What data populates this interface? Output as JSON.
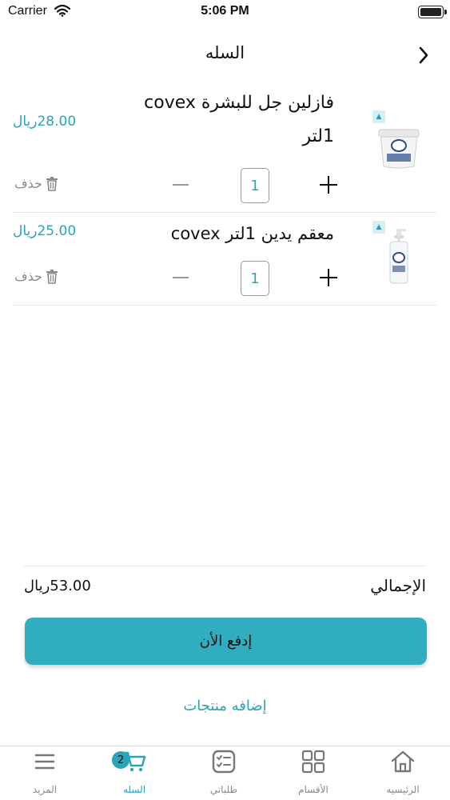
{
  "status_bar": {
    "carrier": "Carrier",
    "time": "5:06 PM"
  },
  "nav": {
    "title": "السله"
  },
  "cart": {
    "items": [
      {
        "name_line1": "فازلين جل للبشرة covex",
        "name_line2": "1لتر",
        "price": "28.00ريال",
        "quantity": "1",
        "delete_label": "حذف"
      },
      {
        "name_line1": "معقم يدين 1لتر covex",
        "price": "25.00ريال",
        "quantity": "1",
        "delete_label": "حذف"
      }
    ]
  },
  "summary": {
    "total_label": "الإجمالي",
    "total_value": "53.00ريال"
  },
  "actions": {
    "pay_label": "إدفع الأن",
    "add_products_label": "إضافه منتجات"
  },
  "tab_bar": {
    "tabs": [
      {
        "label": "الرئيسيه",
        "icon": "home-icon"
      },
      {
        "label": "الأقسام",
        "icon": "grid-icon"
      },
      {
        "label": "طلباتي",
        "icon": "checklist-icon"
      },
      {
        "label": "السله",
        "icon": "cart-icon",
        "badge": "2"
      },
      {
        "label": "المزيد",
        "icon": "menu-icon"
      }
    ]
  },
  "colors": {
    "accent": "#2ba4b8",
    "button": "#30adbe",
    "muted": "#8a8a8a"
  }
}
